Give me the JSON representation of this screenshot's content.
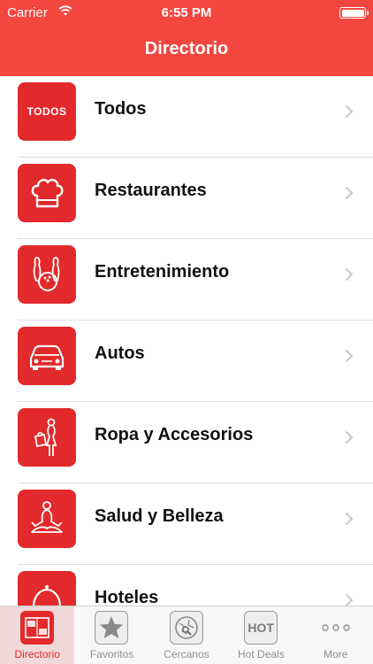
{
  "status_bar": {
    "carrier": "Carrier",
    "time": "6:55 PM"
  },
  "nav": {
    "title": "Directorio"
  },
  "list": [
    {
      "label": "Todos",
      "icon": "todos-badge-icon",
      "icon_text": "TODOS"
    },
    {
      "label": "Restaurantes",
      "icon": "chef-hat-icon"
    },
    {
      "label": "Entretenimiento",
      "icon": "bowling-icon"
    },
    {
      "label": "Autos",
      "icon": "car-icon"
    },
    {
      "label": "Ropa y Accesorios",
      "icon": "shopping-woman-icon"
    },
    {
      "label": "Salud y Belleza",
      "icon": "meditation-icon"
    },
    {
      "label": "Hoteles",
      "icon": "hotel-bell-icon"
    }
  ],
  "tabbar": {
    "tabs": [
      {
        "label": "Directorio",
        "icon": "directory-icon",
        "active": true
      },
      {
        "label": "Favoritos",
        "icon": "star-icon"
      },
      {
        "label": "Cercanos",
        "icon": "map-icon"
      },
      {
        "label": "Hot Deals",
        "icon": "hot-icon",
        "icon_text": "HOT"
      },
      {
        "label": "More",
        "icon": "more-dots-icon"
      }
    ]
  },
  "colors": {
    "accent": "#f2463f",
    "icon_bg": "#e2292b",
    "separator": "#dcdcdc"
  }
}
